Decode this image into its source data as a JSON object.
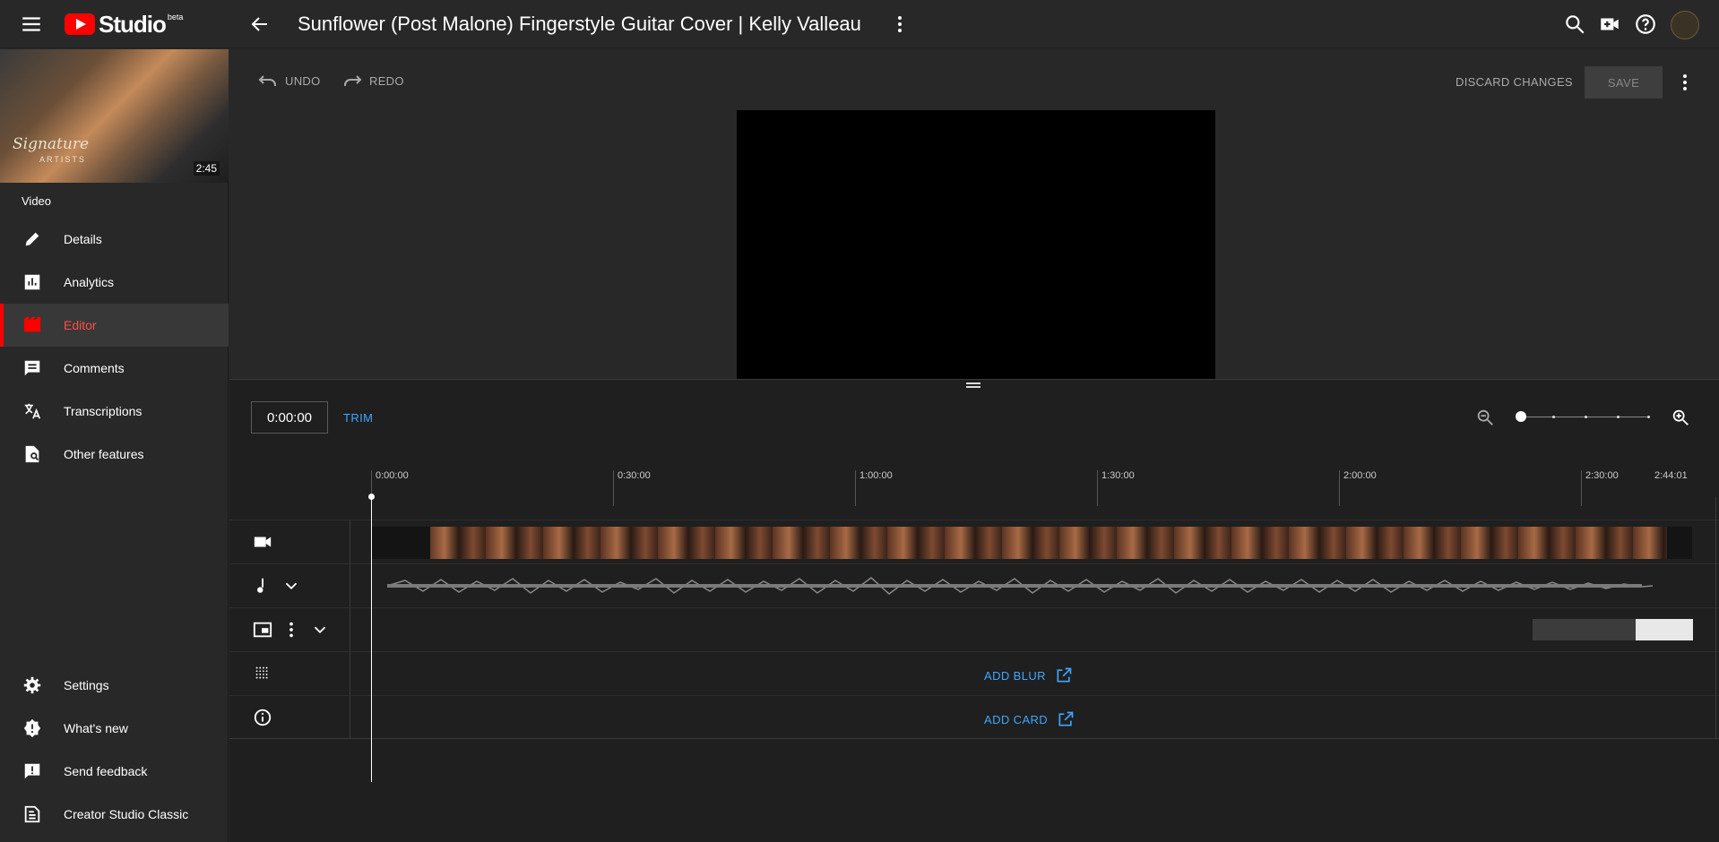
{
  "app": {
    "logo_text": "Studio",
    "logo_badge": "beta",
    "video_title": "Sunflower (Post Malone) Fingerstyle Guitar Cover | Kelly Valleau"
  },
  "sidebar": {
    "thumbnail": {
      "brand_script": "Signature",
      "brand_sub": "ARTISTS",
      "duration": "2:45"
    },
    "section_label": "Video",
    "items": [
      {
        "label": "Details",
        "icon": "pencil-icon"
      },
      {
        "label": "Analytics",
        "icon": "analytics-icon"
      },
      {
        "label": "Editor",
        "icon": "editor-icon",
        "active": true
      },
      {
        "label": "Comments",
        "icon": "comment-icon"
      },
      {
        "label": "Transcriptions",
        "icon": "translate-icon"
      },
      {
        "label": "Other features",
        "icon": "other-features-icon"
      }
    ],
    "bottom_items": [
      {
        "label": "Settings",
        "icon": "gear-icon"
      },
      {
        "label": "What's new",
        "icon": "whats-new-icon"
      },
      {
        "label": "Send feedback",
        "icon": "feedback-icon"
      },
      {
        "label": "Creator Studio Classic",
        "icon": "classic-icon"
      }
    ]
  },
  "editor_bar": {
    "undo": "UNDO",
    "redo": "REDO",
    "discard": "DISCARD CHANGES",
    "save": "SAVE"
  },
  "timeline": {
    "current_time": "0:00:00",
    "trim": "TRIM",
    "ticks": [
      "0:00:00",
      "0:30:00",
      "1:00:00",
      "1:30:00",
      "2:00:00",
      "2:30:00"
    ],
    "end_time": "2:44:01",
    "add_blur": "ADD BLUR",
    "add_card": "ADD CARD",
    "zoom_level": 0
  },
  "colors": {
    "accent_red": "#ff0000",
    "link_blue": "#3ea6ff",
    "background": "#282828"
  }
}
